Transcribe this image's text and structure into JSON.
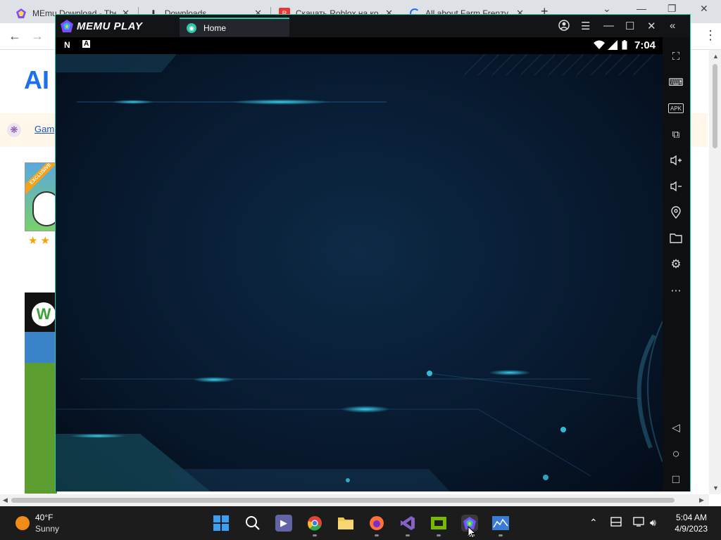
{
  "browser": {
    "tabs": [
      {
        "title": "MEmu Download - The",
        "icon": "memu-icon"
      },
      {
        "title": "Downloads",
        "icon": "download-icon"
      },
      {
        "title": "Скачать Roblox на ко",
        "icon": "site-icon"
      },
      {
        "title": "All about Farm Frenzy",
        "icon": "loading-icon"
      }
    ],
    "newtab": "+",
    "back": "←",
    "forward": "→",
    "menu": "⋮"
  },
  "page": {
    "logo": "AI",
    "games_link": "Gam",
    "thumb_badge": "EXCLUSIVE",
    "stars": "★★",
    "w_logo": "W"
  },
  "memu": {
    "brand": "MEMU PLAY",
    "home_tab": "Home",
    "status": {
      "left_icons": [
        "N",
        "A"
      ],
      "time": "7:04"
    },
    "title_icons": [
      "account-icon",
      "menu-icon",
      "minimize-icon",
      "maximize-icon",
      "close-icon",
      "collapse-icon"
    ],
    "sidebar": [
      {
        "name": "fullscreen-icon",
        "glyph": "⛶"
      },
      {
        "name": "keyboard-icon",
        "glyph": "⌨"
      },
      {
        "name": "apk-icon",
        "glyph": "APK"
      },
      {
        "name": "multi-window-icon",
        "glyph": "⧉"
      },
      {
        "name": "volume-up-icon",
        "glyph": "🔊"
      },
      {
        "name": "volume-down-icon",
        "glyph": "🔉"
      },
      {
        "name": "location-icon",
        "glyph": "⌖"
      },
      {
        "name": "folder-icon",
        "glyph": "🗀"
      },
      {
        "name": "settings-icon",
        "glyph": "⚙"
      },
      {
        "name": "more-icon",
        "glyph": "⋯"
      },
      {
        "name": "back-nav-icon",
        "glyph": "◁"
      },
      {
        "name": "home-nav-icon",
        "glyph": "○"
      },
      {
        "name": "recents-nav-icon",
        "glyph": "□"
      }
    ]
  },
  "taskbar": {
    "weather_temp": "40°F",
    "weather_cond": "Sunny",
    "apps": [
      {
        "name": "start-icon",
        "color": "#3aa0f3"
      },
      {
        "name": "search-icon",
        "color": "#1c1c1c"
      },
      {
        "name": "meet-icon",
        "color": "#6264a7"
      },
      {
        "name": "chrome-icon",
        "color": "#e0443a"
      },
      {
        "name": "file-explorer-icon",
        "color": "#f2c94c"
      },
      {
        "name": "firefox-icon",
        "color": "#ff7139"
      },
      {
        "name": "visual-studio-icon",
        "color": "#8661c5"
      },
      {
        "name": "nvidia-icon",
        "color": "#76b900"
      },
      {
        "name": "memu-taskbar-icon",
        "color": "#2ec6a6"
      },
      {
        "name": "resource-monitor-icon",
        "color": "#3a7bd5"
      }
    ],
    "time": "5:04 AM",
    "date": "4/9/2023"
  }
}
